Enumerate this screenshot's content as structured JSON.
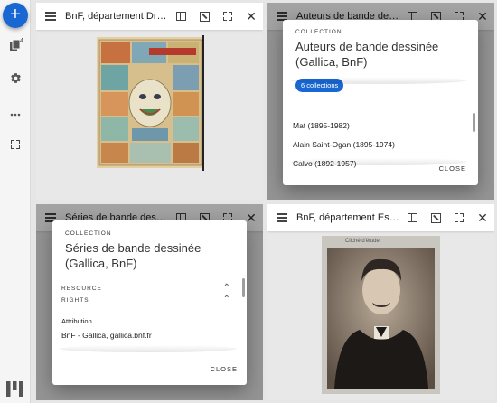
{
  "rail": {
    "add_label": "+",
    "collections_count": "4"
  },
  "windows": [
    {
      "title": "BnF, département Droit,…"
    },
    {
      "title": "Auteurs de bande dessiné"
    },
    {
      "title": "Séries de bande dessiné"
    },
    {
      "title": "BnF, département Esta…"
    }
  ],
  "dialog_collections": {
    "overline": "COLLECTION",
    "title": "Auteurs de bande dessinée (Gallica, BnF)",
    "chip": "6 collections",
    "items": [
      "Mat (1895-1982)",
      "Alain Saint-Ogan (1895-1974)",
      "Calvo (1892-1957)"
    ],
    "close": "CLOSE"
  },
  "dialog_series": {
    "overline": "COLLECTION",
    "title": "Séries de bande dessinée (Gallica, BnF)",
    "section_resource": "RESOURCE",
    "section_rights": "RIGHTS",
    "attribution_label": "Attribution",
    "attribution_value": "BnF - Gallica, gallica.bnf.fr",
    "close": "CLOSE"
  },
  "image_comic": {
    "caption": "ILLUSTRÉ"
  },
  "image_portrait": {
    "caption": "Cliché d'étude"
  },
  "colors": {
    "primary": "#1967d2"
  }
}
